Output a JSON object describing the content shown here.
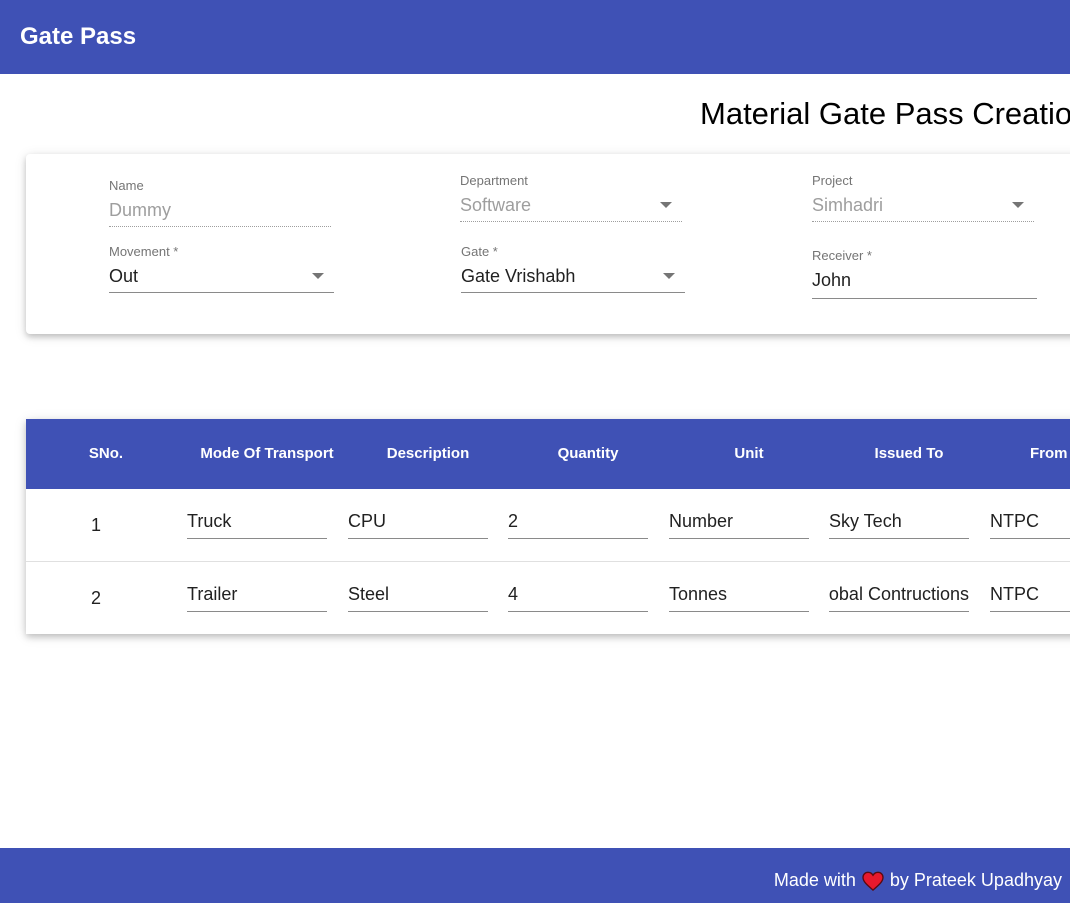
{
  "appbar": {
    "title": "Gate Pass"
  },
  "page": {
    "title": "Material Gate Pass Creation"
  },
  "form": {
    "name": {
      "label": "Name",
      "value": "Dummy"
    },
    "department": {
      "label": "Department",
      "value": "Software"
    },
    "project": {
      "label": "Project",
      "value": "Simhadri"
    },
    "movement": {
      "label": "Movement *",
      "value": "Out"
    },
    "gate": {
      "label": "Gate *",
      "value": "Gate Vrishabh"
    },
    "receiver": {
      "label": "Receiver *",
      "value": "John"
    }
  },
  "table": {
    "headers": [
      "SNo.",
      "Mode Of Transport",
      "Description",
      "Quantity",
      "Unit",
      "Issued To",
      "From"
    ],
    "rows": [
      {
        "sno": "1",
        "mode": "Truck",
        "description": "CPU",
        "quantity": "2",
        "unit": "Number",
        "issued_to": "Sky Tech",
        "from": "NTPC"
      },
      {
        "sno": "2",
        "mode": "Trailer",
        "description": "Steel",
        "quantity": "4",
        "unit": "Tonnes",
        "issued_to": "Global Contructions",
        "from": "NTPC"
      }
    ]
  },
  "footer": {
    "made_with": "Made with",
    "by": "by Prateek Upadhyay",
    "heart_color": "#e8192c",
    "icon": "heart-icon"
  },
  "colors": {
    "primary": "#3f51b5"
  }
}
